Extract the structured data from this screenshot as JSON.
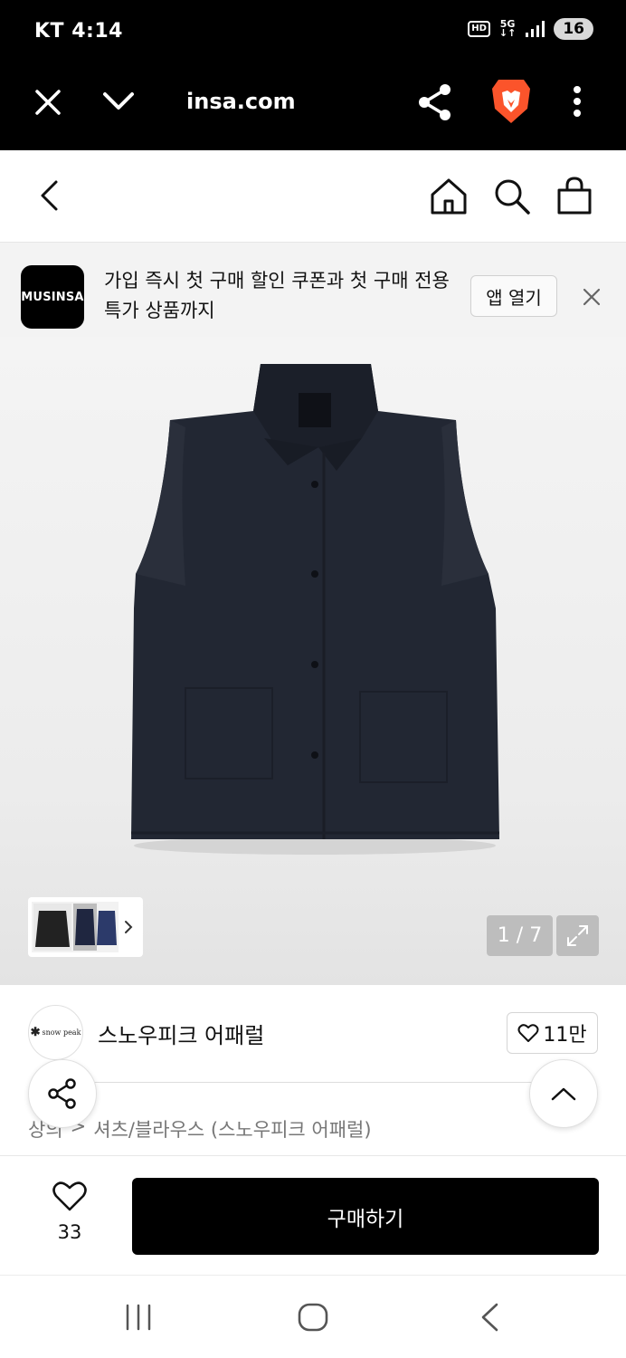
{
  "status_bar": {
    "carrier": "KT",
    "time": "4:14",
    "hd_badge": "HD",
    "network": "5G",
    "battery": "16"
  },
  "browser": {
    "url": "insa.com"
  },
  "app_banner": {
    "logo_text": "MUSINSA",
    "message": "가입 즉시 첫 구매 할인 쿠폰과 첫 구매 전용 특가 상품까지",
    "open_app_label": "앱 열기"
  },
  "gallery": {
    "counter": "1 / 7"
  },
  "brand": {
    "logo_text": "snow peak",
    "name": "스노우피크 어패럴",
    "likes": "11만"
  },
  "breadcrumb": {
    "first": "상의",
    "separator": ">",
    "category": "셔츠/블라우스 (스노우피크 어패럴)"
  },
  "purchase": {
    "wish_count": "33",
    "buy_label": "구매하기"
  },
  "colors": {
    "primary": "#000000",
    "garment": "#222733"
  }
}
